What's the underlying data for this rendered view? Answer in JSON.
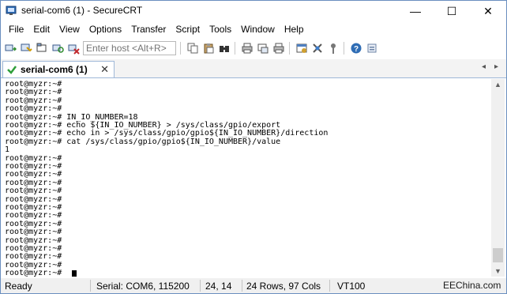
{
  "window": {
    "title": "serial-com6 (1) - SecureCRT",
    "minimize_glyph": "—",
    "maximize_glyph": "☐",
    "close_glyph": "✕"
  },
  "menu": [
    "File",
    "Edit",
    "View",
    "Options",
    "Transfer",
    "Script",
    "Tools",
    "Window",
    "Help"
  ],
  "toolbar": {
    "quick_connect_placeholder": "Enter host <Alt+R>",
    "group1": [
      "connect-icon",
      "quick-connect-icon",
      "connect-tab-icon",
      "reconnect-icon",
      "disconnect-icon"
    ],
    "group2": [
      "copy-icon",
      "paste-icon",
      "find-icon"
    ],
    "group3": [
      "print-icon",
      "print-setup-icon",
      "print-preview-icon"
    ],
    "group4": [
      "session-options-icon",
      "keymap-icon",
      "sftp-icon"
    ],
    "group5": [
      "help-icon",
      "about-icon"
    ]
  },
  "tab": {
    "label": "serial-com6 (1)",
    "close_glyph": "✕",
    "prev_glyph": "◂",
    "next_glyph": "▸"
  },
  "terminal": {
    "lines": [
      "root@myzr:~#",
      "root@myzr:~#",
      "root@myzr:~#",
      "root@myzr:~#",
      "root@myzr:~# IN_IO_NUMBER=18",
      "root@myzr:~# echo ${IN_IO_NUMBER} > /sys/class/gpio/export",
      "root@myzr:~# echo in > /sys/class/gpio/gpio${IN_IO_NUMBER}/direction",
      "root@myzr:~# cat /sys/class/gpio/gpio${IN_IO_NUMBER}/value",
      "1",
      "root@myzr:~#",
      "root@myzr:~#",
      "root@myzr:~#",
      "root@myzr:~#",
      "root@myzr:~#",
      "root@myzr:~#",
      "root@myzr:~#",
      "root@myzr:~#",
      "root@myzr:~#",
      "root@myzr:~#",
      "root@myzr:~#",
      "root@myzr:~#",
      "root@myzr:~#",
      "root@myzr:~#",
      "root@myzr:~#"
    ]
  },
  "status": {
    "ready": "Ready",
    "serial": "Serial: COM6, 115200",
    "position": "24,  14",
    "size": "24 Rows, 97 Cols",
    "emulation": "VT100",
    "watermark": "EEChina.com"
  }
}
